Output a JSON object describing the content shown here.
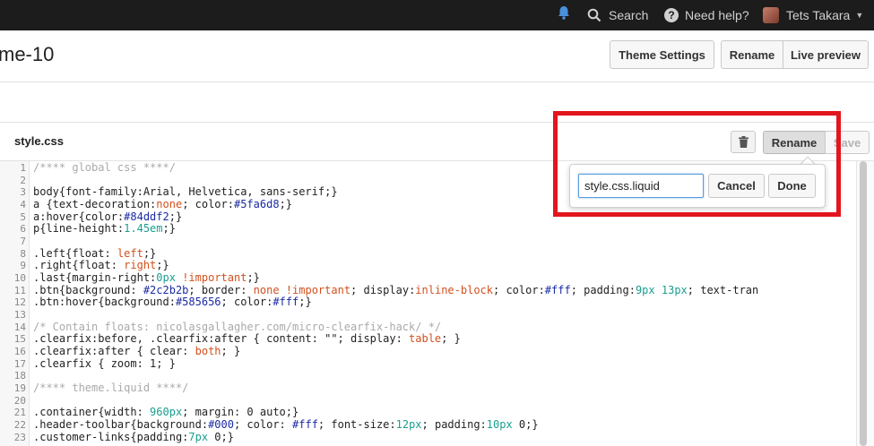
{
  "topbar": {
    "search_label": "Search",
    "help_label": "Need help?",
    "user_name": "Tets Takara"
  },
  "header": {
    "title": "me-10",
    "theme_settings_label": "Theme Settings",
    "rename_label": "Rename",
    "live_preview_label": "Live preview"
  },
  "file": {
    "name": "style.css",
    "rename_label": "Rename",
    "save_label": "Save"
  },
  "rename_popover": {
    "input_value": "style.css.liquid",
    "cancel_label": "Cancel",
    "done_label": "Done"
  },
  "editor": {
    "line_numbers": [
      "1",
      "2",
      "3",
      "4",
      "5",
      "6",
      "7",
      "8",
      "9",
      "10",
      "11",
      "12",
      "13",
      "14",
      "15",
      "16",
      "17",
      "18",
      "19",
      "20",
      "21",
      "22",
      "23"
    ],
    "lines": [
      "/**** global css ****/",
      "",
      "body{font-family:Arial, Helvetica, sans-serif;}",
      "a {text-decoration:none; color:#5fa6d8;}",
      "a:hover{color:#84ddf2;}",
      "p{line-height:1.45em;}",
      "",
      ".left{float: left;}",
      ".right{float: right;}",
      ".last{margin-right:0px !important;}",
      ".btn{background: #2c2b2b; border: none !important; display:inline-block; color:#fff; padding:9px 13px; text-tran",
      ".btn:hover{background:#585656; color:#fff;}",
      "",
      "/* Contain floats: nicolasgallagher.com/micro-clearfix-hack/ */",
      ".clearfix:before, .clearfix:after { content: \"\"; display: table; }",
      ".clearfix:after { clear: both; }",
      ".clearfix { zoom: 1; }",
      "",
      "/**** theme.liquid ****/",
      "",
      ".container{width: 960px; margin: 0 auto;}",
      ".header-toolbar{background:#000; color: #fff; font-size:12px; padding:10px 0;}",
      ".customer-links{padding:7px 0;}"
    ]
  }
}
